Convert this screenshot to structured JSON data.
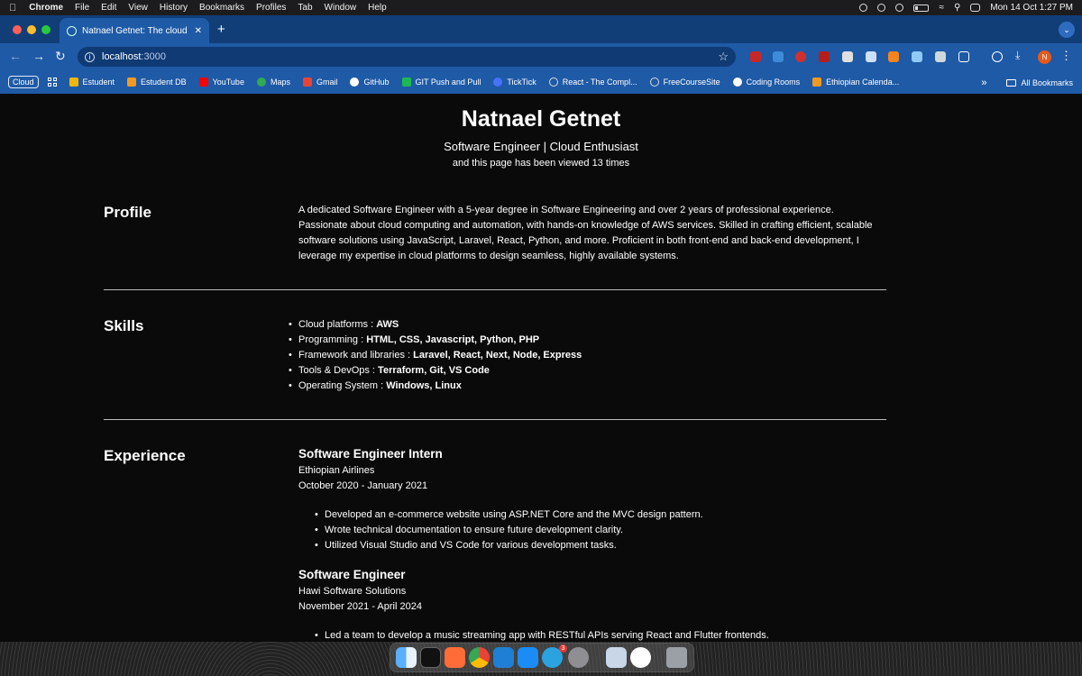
{
  "menubar": {
    "app": "Chrome",
    "items": [
      "File",
      "Edit",
      "View",
      "History",
      "Bookmarks",
      "Profiles",
      "Tab",
      "Window",
      "Help"
    ],
    "datetime": "Mon 14 Oct  1:27 PM"
  },
  "browser": {
    "tab_title": "Natnael Getnet: The cloud re...",
    "url_host": "localhost",
    "url_port": ":3000",
    "profile_initial": "N",
    "bookmarks_cloud": "Cloud",
    "bookmarks": [
      {
        "label": "Estudent",
        "color": "#f2b705"
      },
      {
        "label": "Estudent DB",
        "color": "#f29a1f"
      },
      {
        "label": "YouTube",
        "color": "#ff0000"
      },
      {
        "label": "Maps",
        "color": "#34a853"
      },
      {
        "label": "Gmail",
        "color": "#ea4335"
      },
      {
        "label": "GitHub",
        "color": "#ffffff"
      },
      {
        "label": "GIT Push and Pull",
        "color": "#1db954"
      },
      {
        "label": "TickTick",
        "color": "#4772fa"
      },
      {
        "label": "React - The Compl...",
        "color": "#dddddd"
      },
      {
        "label": "FreeCourseSite",
        "color": "#dddddd"
      },
      {
        "label": "Coding Rooms",
        "color": "#ffffff"
      },
      {
        "label": "Ethiopian Calenda...",
        "color": "#f29a1f"
      }
    ],
    "all_bookmarks": "All Bookmarks"
  },
  "resume": {
    "name": "Natnael Getnet",
    "subtitle": "Software Engineer | Cloud Enthusiast",
    "views_text": "and this page has been viewed 13 times",
    "profile": {
      "title": "Profile",
      "text": "A dedicated Software Engineer with a 5-year degree in Software Engineering and over 2 years of professional experience. Passionate about cloud computing and automation, with hands-on knowledge of AWS services. Skilled in crafting efficient, scalable software solutions using JavaScript, Laravel, React, Python, and more. Proficient in both front-end and back-end development, I leverage my expertise in cloud platforms to design seamless, highly available systems."
    },
    "skills": {
      "title": "Skills",
      "items": [
        {
          "label": "Cloud platforms : ",
          "value": "AWS"
        },
        {
          "label": "Programming : ",
          "value": "HTML, CSS, Javascript, Python, PHP"
        },
        {
          "label": "Framework and libraries : ",
          "value": "Laravel, React, Next, Node, Express"
        },
        {
          "label": "Tools & DevOps : ",
          "value": "Terraform, Git, VS Code"
        },
        {
          "label": "Operating System : ",
          "value": "Windows, Linux"
        }
      ]
    },
    "experience": {
      "title": "Experience",
      "jobs": [
        {
          "title": "Software Engineer Intern",
          "company": "Ethiopian Airlines",
          "period": "October 2020 - January 2021",
          "bullets": [
            "Developed an e-commerce website using ASP.NET Core and the MVC design pattern.",
            "Wrote technical documentation to ensure future development clarity.",
            "Utilized Visual Studio and VS Code for various development tasks."
          ]
        },
        {
          "title": "Software Engineer",
          "company": "Hawi Software Solutions",
          "period": "November 2021 - April 2024",
          "bullets": [
            "Led a team to develop a music streaming app with RESTful APIs serving React and Flutter frontends."
          ]
        }
      ]
    }
  },
  "dock": {
    "telegram_badge": "3"
  }
}
